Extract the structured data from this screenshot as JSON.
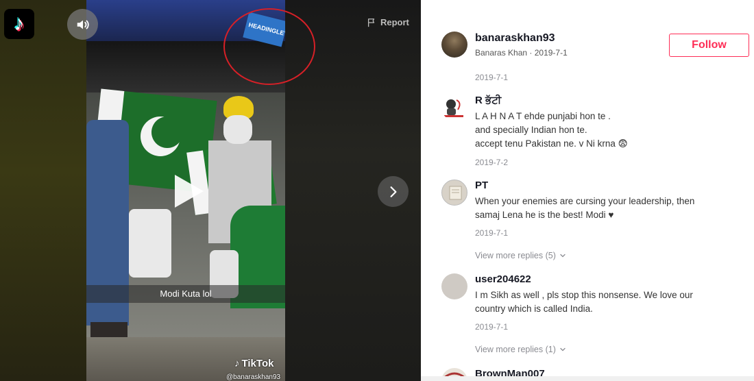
{
  "video": {
    "caption_overlay": "Modi Kuta lol",
    "watermark_brand": "TikTok",
    "watermark_handle": "@banaraskhan93",
    "stadium_banner_text": "HEADINGLEY",
    "report_label": "Report"
  },
  "icons": {
    "logo": "tiktok-logo-icon",
    "volume": "volume-icon",
    "report": "flag-icon",
    "play": "play-icon",
    "next": "chevron-right-icon",
    "replies_chevron": "chevron-down-icon"
  },
  "author": {
    "username": "banaraskhan93",
    "meta": "Banaras Khan · 2019-7-1",
    "follow_label": "Follow",
    "post_date": "2019-7-1"
  },
  "comments": [
    {
      "user": "R ਭੱਟੀ",
      "lines": [
        "L A H N A T ehde punjabi hon te .",
        "and specially Indian hon te.",
        "accept tenu Pakistan ne. v Ni krna 😨"
      ],
      "date": "2019-7-2"
    },
    {
      "user": "PT",
      "lines": [
        "When your enemies are cursing your leadership, then",
        "samaj Lena he is the best! Modi ♥"
      ],
      "date": "2019-7-1",
      "replies": "View more replies (5)"
    },
    {
      "user": "user204622",
      "lines": [
        "I m Sikh as well , pls stop this nonsense. We love our",
        "country which is called India."
      ],
      "date": "2019-7-1",
      "replies": "View more replies (1)"
    },
    {
      "user": "BrownMan007"
    }
  ],
  "colors": {
    "accent": "#fe2c55",
    "annotation": "#d72027",
    "muted_text": "#8a8b91"
  }
}
